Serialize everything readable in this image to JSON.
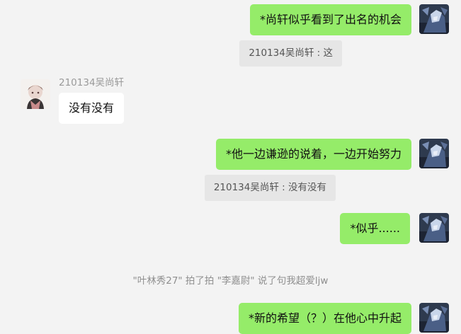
{
  "chat": {
    "messages": [
      {
        "from": "me",
        "text": "*尚轩似乎看到了出名的机会",
        "quote": "210134吴尚轩 : 这"
      },
      {
        "from": "other",
        "sender": "210134吴尚轩",
        "text": "没有没有"
      },
      {
        "from": "me",
        "text": "*他一边谦逊的说着，一边开始努力",
        "quote": "210134吴尚轩 : 没有没有"
      },
      {
        "from": "me",
        "text": "*似乎......"
      },
      {
        "from": "me",
        "text": "*新的希望（？）在他心中升起"
      }
    ],
    "system_note": "\"叶林秀27\" 拍了拍 \"李嘉尉\" 说了句我超爱ljw"
  },
  "colors": {
    "background": "#f3f3f3",
    "my_bubble": "#95ec69",
    "other_bubble": "#ffffff",
    "quote_background": "#e6e6e6",
    "muted_text": "#9a9a9a"
  },
  "icons": {
    "my_avatar": "anime-character-avatar-icon",
    "other_avatar": "girl-illustration-avatar-icon"
  }
}
